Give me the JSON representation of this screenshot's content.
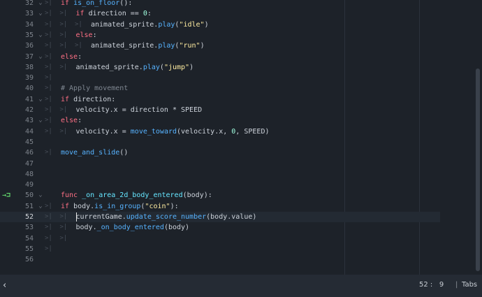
{
  "editor": {
    "current_line": "52",
    "lines": [
      {
        "num": "32",
        "fold": "⌄",
        "tabs": 1,
        "code": [
          [
            "kw",
            "if "
          ],
          [
            "call",
            "is_on_floor"
          ],
          [
            "p",
            "():"
          ]
        ]
      },
      {
        "num": "33",
        "fold": "⌄",
        "tabs": 2,
        "code": [
          [
            "kw",
            "if "
          ],
          [
            "p",
            "direction == "
          ],
          [
            "num",
            "0"
          ],
          [
            "p",
            ":"
          ]
        ]
      },
      {
        "num": "34",
        "fold": "",
        "tabs": 3,
        "code": [
          [
            "p",
            "animated_sprite."
          ],
          [
            "call",
            "play"
          ],
          [
            "p",
            "("
          ],
          [
            "str",
            "\"idle\""
          ],
          [
            "p",
            ")"
          ]
        ]
      },
      {
        "num": "35",
        "fold": "⌄",
        "tabs": 2,
        "code": [
          [
            "kw",
            "else"
          ],
          [
            "p",
            ":"
          ]
        ]
      },
      {
        "num": "36",
        "fold": "",
        "tabs": 3,
        "code": [
          [
            "p",
            "animated_sprite."
          ],
          [
            "call",
            "play"
          ],
          [
            "p",
            "("
          ],
          [
            "str",
            "\"run\""
          ],
          [
            "p",
            ")"
          ]
        ]
      },
      {
        "num": "37",
        "fold": "⌄",
        "tabs": 1,
        "code": [
          [
            "kw",
            "else"
          ],
          [
            "p",
            ":"
          ]
        ]
      },
      {
        "num": "38",
        "fold": "",
        "tabs": 2,
        "code": [
          [
            "p",
            "animated_sprite."
          ],
          [
            "call",
            "play"
          ],
          [
            "p",
            "("
          ],
          [
            "str",
            "\"jump\""
          ],
          [
            "p",
            ")"
          ]
        ]
      },
      {
        "num": "39",
        "fold": "",
        "tabs": 1,
        "code": []
      },
      {
        "num": "40",
        "fold": "",
        "tabs": 1,
        "code": [
          [
            "cm",
            "# Apply movement"
          ]
        ]
      },
      {
        "num": "41",
        "fold": "⌄",
        "tabs": 1,
        "code": [
          [
            "kw",
            "if "
          ],
          [
            "p",
            "direction:"
          ]
        ]
      },
      {
        "num": "42",
        "fold": "",
        "tabs": 2,
        "code": [
          [
            "p",
            "velocity.x = direction * SPEED"
          ]
        ]
      },
      {
        "num": "43",
        "fold": "⌄",
        "tabs": 1,
        "code": [
          [
            "kw",
            "else"
          ],
          [
            "p",
            ":"
          ]
        ]
      },
      {
        "num": "44",
        "fold": "",
        "tabs": 2,
        "code": [
          [
            "p",
            "velocity.x = "
          ],
          [
            "call",
            "move_toward"
          ],
          [
            "p",
            "(velocity.x, "
          ],
          [
            "num",
            "0"
          ],
          [
            "p",
            ", SPEED)"
          ]
        ]
      },
      {
        "num": "45",
        "fold": "",
        "tabs": 0,
        "code": []
      },
      {
        "num": "46",
        "fold": "",
        "tabs": 1,
        "code": [
          [
            "call",
            "move_and_slide"
          ],
          [
            "p",
            "()"
          ]
        ]
      },
      {
        "num": "47",
        "fold": "",
        "tabs": 0,
        "code": []
      },
      {
        "num": "48",
        "fold": "",
        "tabs": 0,
        "code": []
      },
      {
        "num": "49",
        "fold": "",
        "tabs": 0,
        "code": []
      },
      {
        "num": "50",
        "fold": "⌄",
        "tabs": 0,
        "arrow": "→⊐",
        "code": [
          [
            "kw",
            "func "
          ],
          [
            "fn",
            "_on_area_2d_body_entered"
          ],
          [
            "p",
            "(body):"
          ]
        ]
      },
      {
        "num": "51",
        "fold": "⌄",
        "tabs": 1,
        "code": [
          [
            "kw",
            "if "
          ],
          [
            "p",
            "body."
          ],
          [
            "call",
            "is_in_group"
          ],
          [
            "p",
            "("
          ],
          [
            "str",
            "\"coin\""
          ],
          [
            "p",
            "):"
          ]
        ]
      },
      {
        "num": "52",
        "fold": "",
        "tabs": 2,
        "caret": true,
        "code": [
          [
            "p",
            "currentGame."
          ],
          [
            "call",
            "update_score_number"
          ],
          [
            "p",
            "(body.value)"
          ]
        ]
      },
      {
        "num": "53",
        "fold": "",
        "tabs": 2,
        "code": [
          [
            "p",
            "body."
          ],
          [
            "call",
            "_on_body_entered"
          ],
          [
            "p",
            "(body)"
          ]
        ]
      },
      {
        "num": "54",
        "fold": "",
        "tabs": 2,
        "code": []
      },
      {
        "num": "55",
        "fold": "",
        "tabs": 1,
        "code": []
      },
      {
        "num": "56",
        "fold": "",
        "tabs": 0,
        "code": []
      }
    ]
  },
  "status": {
    "toggle_icon": "‹",
    "line": "52",
    "col": "9",
    "cursor_sep": ":",
    "indent_sep": "|",
    "indent_mode": "Tabs"
  },
  "colors": {
    "background": "#1d2229",
    "keyword": "#ff7085",
    "function_def": "#66e6ff",
    "call": "#57b3ff",
    "string": "#ffeda1",
    "number": "#a1ffe0",
    "comment": "#7f8791"
  }
}
